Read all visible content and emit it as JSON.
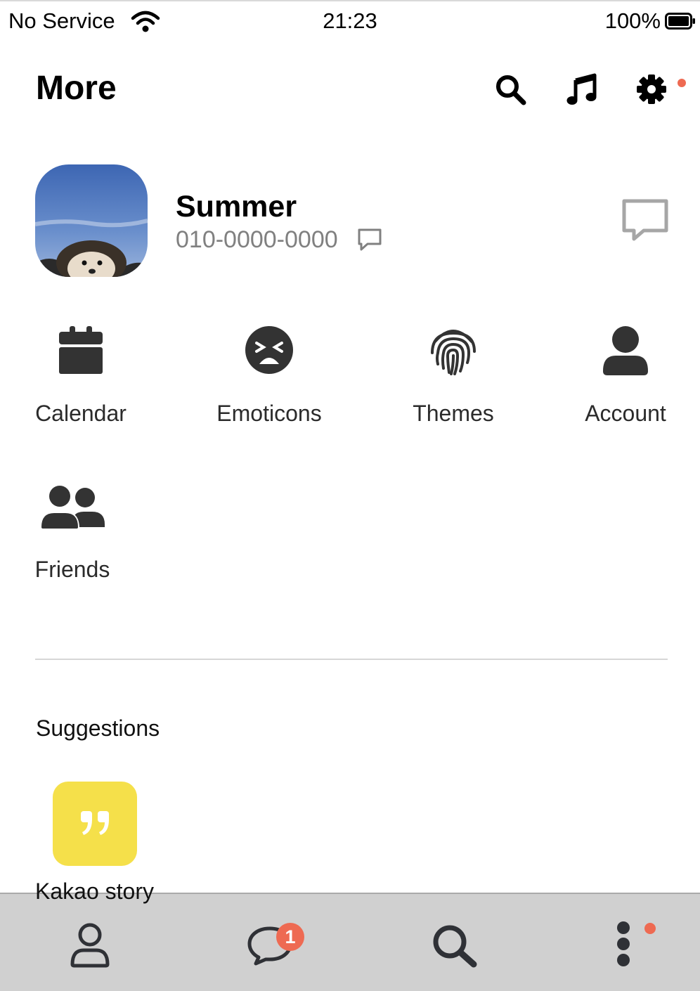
{
  "status_bar": {
    "carrier": "No Service",
    "time": "21:23",
    "battery": "100%",
    "wifi_icon": "wifi-icon",
    "battery_icon": "battery-full-icon"
  },
  "header": {
    "title": "More",
    "icons": [
      "search-icon",
      "music-note-icon",
      "gear-icon"
    ],
    "notification_dot_color": "#ee6a52"
  },
  "profile": {
    "name": "Summer",
    "phone": "010-0000-0000",
    "avatar_icon": "hedgehog-photo",
    "chat_icon": "chat-bubble-icon"
  },
  "menu": [
    {
      "label": "Calendar",
      "icon": "calendar-icon"
    },
    {
      "label": "Emoticons",
      "icon": "tired-face-icon"
    },
    {
      "label": "Themes",
      "icon": "fingerprint-icon"
    },
    {
      "label": "Account",
      "icon": "person-icon"
    },
    {
      "label": "Friends",
      "icon": "users-icon"
    }
  ],
  "suggestions": {
    "title": "Suggestions",
    "items": [
      {
        "label": "Kakao story",
        "icon": "quote-icon",
        "color": "#f5e04a"
      }
    ]
  },
  "bottom_nav": {
    "items": [
      "profile-tab-icon",
      "chats-tab-icon",
      "search-tab-icon",
      "more-tab-icon"
    ],
    "chat_badge": "1",
    "badge_color": "#ee6a52",
    "background": "#d0d0d0"
  }
}
